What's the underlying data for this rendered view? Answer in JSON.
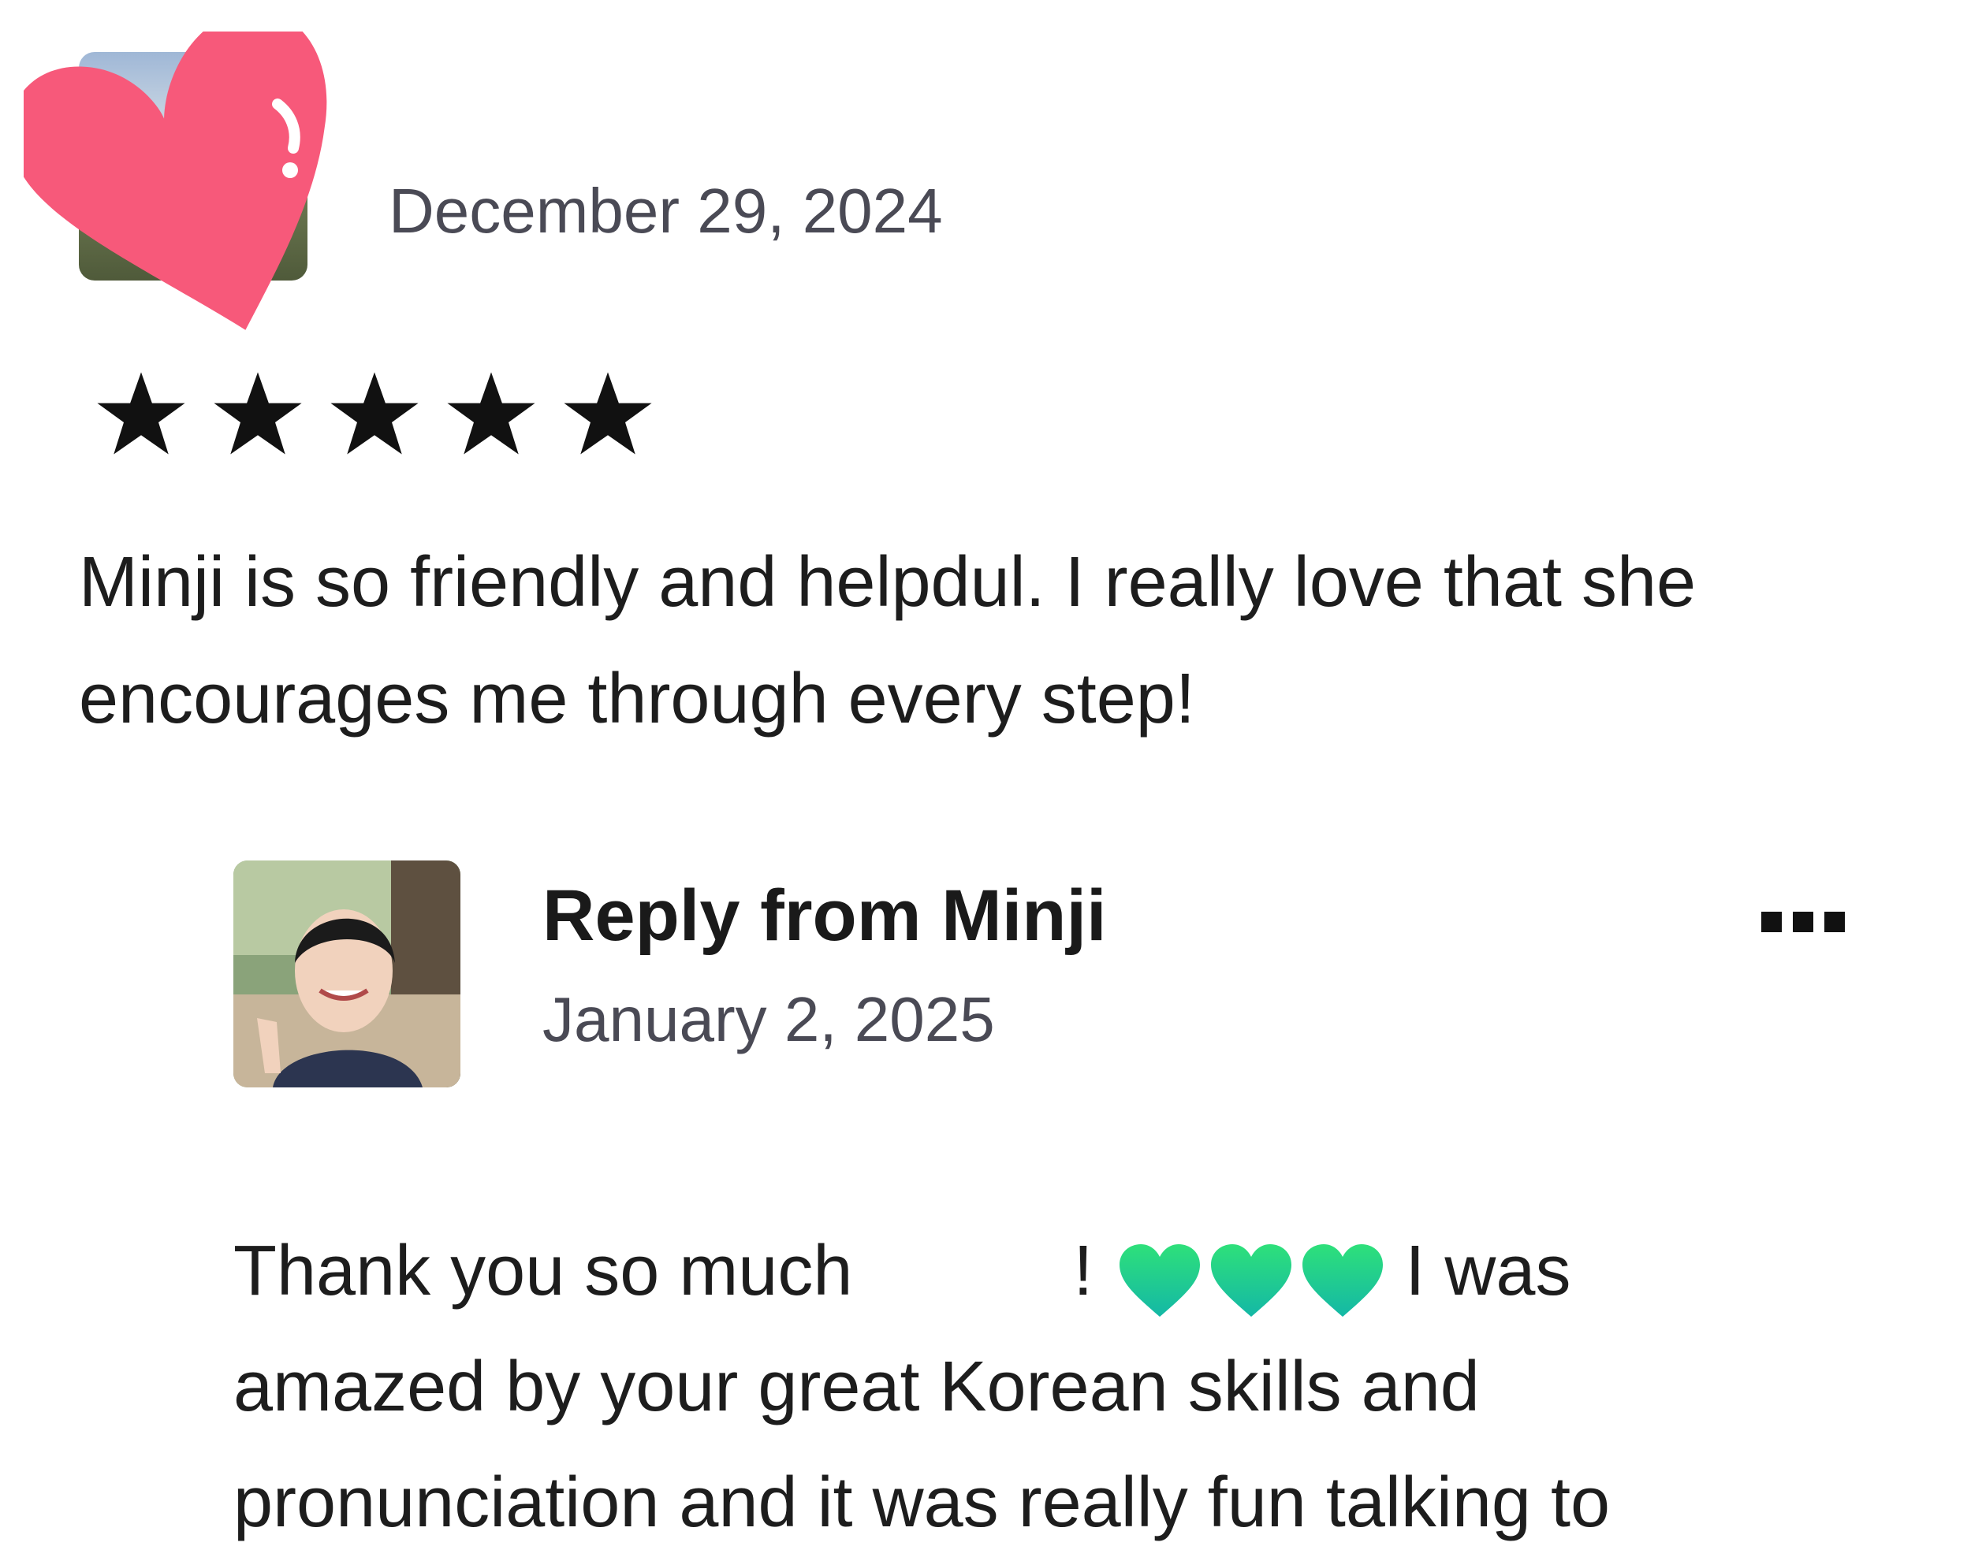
{
  "review": {
    "date": "December 29, 2024",
    "rating": 5,
    "text": "Minji is so friendly and helpdul. I really love that she encourages me through every step!"
  },
  "reply": {
    "title": "Reply from Minji",
    "date": "January 2, 2025",
    "more_icon": "more-options-icon",
    "lines": [
      "Thank you so much",
      "!",
      "I was",
      "amazed by your great Korean skills and",
      "pronunciation and it was really fun talking to"
    ]
  },
  "colors": {
    "heart_sticker": "#f7597a",
    "green_heart": "#1fd67e",
    "star": "#111111",
    "date_text": "#4a4a55"
  },
  "icons": {
    "sticker": "heart-icon",
    "star": "star-icon",
    "emoji": "green-heart-icon"
  }
}
